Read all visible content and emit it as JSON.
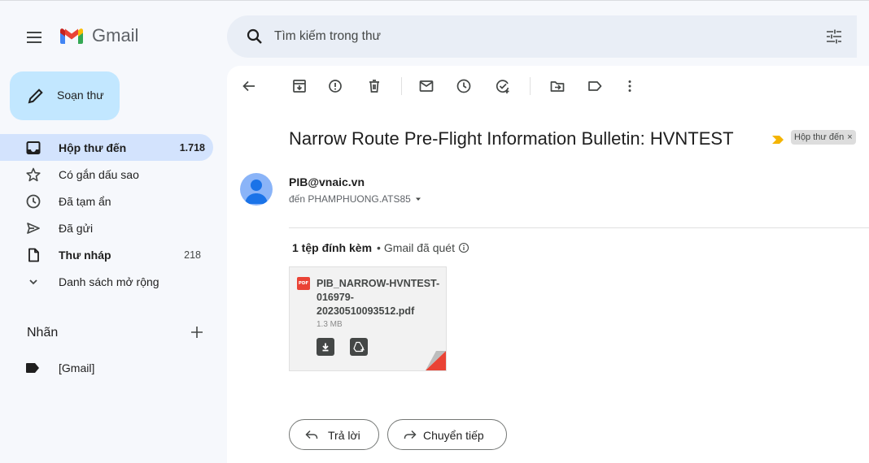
{
  "header": {
    "brand": "Gmail",
    "search_placeholder": "Tìm kiếm trong thư",
    "icons": [
      "menu-icon",
      "gmail-logo",
      "search-icon",
      "tune-icon"
    ]
  },
  "sidebar": {
    "compose_label": "Soạn thư",
    "items": [
      {
        "label": "Hộp thư đến",
        "count": "1.718",
        "icon": "inbox-icon",
        "active": true,
        "bold": true
      },
      {
        "label": "Có gắn dấu sao",
        "count": "",
        "icon": "star-icon"
      },
      {
        "label": "Đã tạm ẩn",
        "count": "",
        "icon": "clock-icon"
      },
      {
        "label": "Đã gửi",
        "count": "",
        "icon": "send-icon"
      },
      {
        "label": "Thư nháp",
        "count": "218",
        "icon": "draft-icon",
        "bold": true
      },
      {
        "label": "Danh sách mở rộng",
        "count": "",
        "icon": "chevron-down-icon"
      }
    ],
    "labels_heading": "Nhãn",
    "labels": [
      {
        "label": "[Gmail]",
        "icon": "label-icon"
      }
    ]
  },
  "toolbar": {
    "icons": [
      "back-arrow-icon",
      "archive-icon",
      "report-spam-icon",
      "delete-icon",
      "mark-unread-icon",
      "snooze-icon",
      "add-to-tasks-icon",
      "move-to-icon",
      "label-icon",
      "more-vert-icon"
    ]
  },
  "email": {
    "subject": "Narrow Route Pre-Flight Information Bulletin: HVNTEST",
    "label_chip": "Hộp thư đến",
    "chip_close": "×",
    "sender": "PIB@vnaic.vn",
    "to": "đến PHAMPHUONG.ATS85",
    "colors": {
      "important": "#f4b400",
      "avatar": "#8ab4f8",
      "compose": "#c2e7ff",
      "active": "#d3e3fd"
    }
  },
  "attachments": {
    "count_label": "1 tệp đính kèm",
    "scan_label": "• Gmail đã quét",
    "files": [
      {
        "type_badge": "PDF",
        "name": "PIB_NARROW-HVNTEST-016979-20230510093512.pdf",
        "size": "1.3 MB"
      }
    ]
  },
  "actions": {
    "reply": "Trả lời",
    "forward": "Chuyển tiếp"
  }
}
